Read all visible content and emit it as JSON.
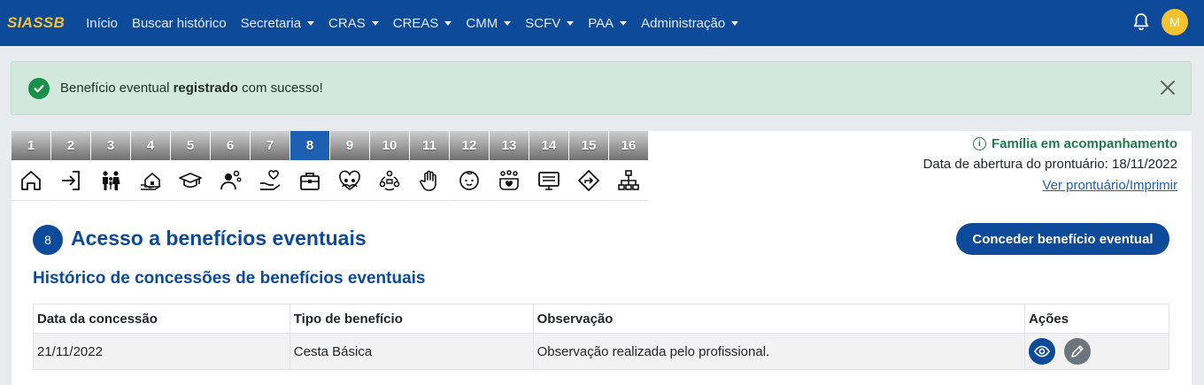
{
  "navbar": {
    "brand": "SIASSB",
    "items": [
      {
        "label": "Início",
        "dropdown": false
      },
      {
        "label": "Buscar histórico",
        "dropdown": false
      },
      {
        "label": "Secretaria",
        "dropdown": true
      },
      {
        "label": "CRAS",
        "dropdown": true
      },
      {
        "label": "CREAS",
        "dropdown": true
      },
      {
        "label": "CMM",
        "dropdown": true
      },
      {
        "label": "SCFV",
        "dropdown": true
      },
      {
        "label": "PAA",
        "dropdown": true
      },
      {
        "label": "Administração",
        "dropdown": true
      }
    ],
    "avatar_initial": "M",
    "notification_icon": "bell-icon",
    "colors": {
      "bar": "#0d4a99",
      "brand": "#f2c230"
    }
  },
  "alert": {
    "text_before": "Benefício eventual ",
    "text_bold": "registrado",
    "text_after": " com sucesso!",
    "icon": "check-circle-icon",
    "close_icon": "close-icon",
    "color": "#d3e9dd"
  },
  "tabs": {
    "active": "8",
    "items": [
      {
        "number": "1",
        "icon": "home-icon"
      },
      {
        "number": "2",
        "icon": "login-icon"
      },
      {
        "number": "3",
        "icon": "family-icon"
      },
      {
        "number": "4",
        "icon": "house-hand-icon"
      },
      {
        "number": "5",
        "icon": "graduation-cap-icon"
      },
      {
        "number": "6",
        "icon": "person-gears-icon"
      },
      {
        "number": "7",
        "icon": "hand-heart-icon"
      },
      {
        "number": "8",
        "icon": "briefcase-aid-icon"
      },
      {
        "number": "9",
        "icon": "heart-people-icon"
      },
      {
        "number": "10",
        "icon": "people-link-icon"
      },
      {
        "number": "11",
        "icon": "hand-stop-icon"
      },
      {
        "number": "12",
        "icon": "child-face-icon"
      },
      {
        "number": "13",
        "icon": "group-heart-icon"
      },
      {
        "number": "14",
        "icon": "monitor-icon"
      },
      {
        "number": "15",
        "icon": "direction-sign-icon"
      },
      {
        "number": "16",
        "icon": "hierarchy-icon"
      }
    ]
  },
  "info": {
    "status": "Família em acompanhamento",
    "date_text": "Data de abertura do prontuário: 18/11/2022",
    "link": "Ver prontuário/Imprimir",
    "status_color": "#1f7a4d"
  },
  "main": {
    "step": "8",
    "title": "Acesso a benefícios eventuais",
    "button": "Conceder benefício eventual",
    "section_title": "Histórico de concessões de benefícios eventuais",
    "table": {
      "headers": [
        "Data da concessão",
        "Tipo de benefício",
        "Observação",
        "Ações"
      ],
      "rows": [
        {
          "date": "21/11/2022",
          "type": "Cesta Básica",
          "note": "Observação realizada pelo profissional.",
          "actions": [
            "eye-icon",
            "pencil-icon"
          ]
        }
      ]
    }
  }
}
